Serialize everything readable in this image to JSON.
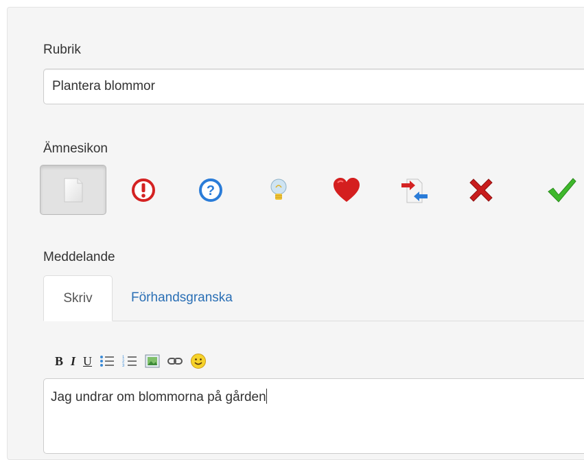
{
  "subject": {
    "label": "Rubrik",
    "value": "Plantera blommor"
  },
  "topic_icons": {
    "label": "Ämnesikon",
    "icons": [
      "document-icon",
      "exclamation-icon",
      "question-icon",
      "lightbulb-icon",
      "heart-icon",
      "redirect-arrows-icon",
      "x-cross-icon",
      "checkmark-icon"
    ],
    "selected": "document-icon"
  },
  "message": {
    "label": "Meddelande",
    "tabs": [
      {
        "label": "Skriv",
        "active": true
      },
      {
        "label": "Förhandsgranska",
        "active": false
      }
    ],
    "toolbar": {
      "bold": "B",
      "italic": "I",
      "underline": "U",
      "icons": [
        "bullet-list-icon",
        "numbered-list-icon",
        "image-icon",
        "link-icon",
        "smiley-icon"
      ]
    },
    "body": "Jag undrar om blommorna på gården"
  },
  "colors": {
    "link": "#2a6fb5",
    "panel_bg": "#f5f5f5",
    "border": "#cccccc"
  }
}
